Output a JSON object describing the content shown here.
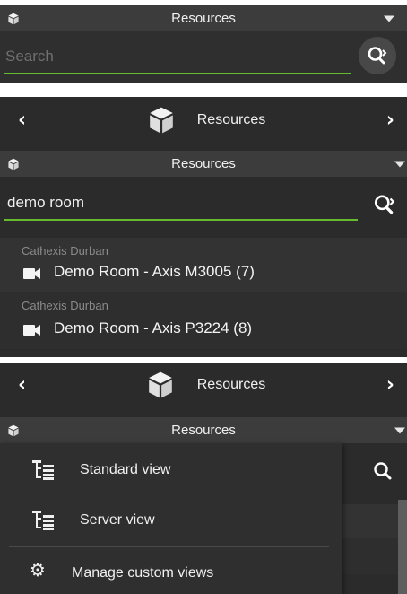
{
  "panel1": {
    "header": {
      "title": "Resources",
      "icon": "cube-icon",
      "dropdown_icon": "caret-down-icon"
    },
    "search": {
      "placeholder": "Search",
      "value": "",
      "button_icon": "search-icon"
    }
  },
  "panel2": {
    "nav": {
      "title": "Resources",
      "icon": "cube-icon",
      "back_icon": "chevron-left-icon",
      "forward_icon": "chevron-right-icon"
    },
    "header": {
      "title": "Resources",
      "icon": "cube-icon",
      "dropdown_icon": "caret-down-icon"
    },
    "search": {
      "value": "demo room",
      "button_icon": "search-icon"
    },
    "results": [
      {
        "site": "Cathexis Durban",
        "name": "Demo Room - Axis M3005 (7)",
        "icon": "camera-icon"
      },
      {
        "site": "Cathexis Durban",
        "name": "Demo Room - Axis P3224 (8)",
        "icon": "camera-icon"
      }
    ]
  },
  "panel3": {
    "nav": {
      "title": "Resources",
      "icon": "cube-icon",
      "back_icon": "chevron-left-icon",
      "forward_icon": "chevron-right-icon"
    },
    "header": {
      "title": "Resources",
      "icon": "cube-icon",
      "dropdown_icon": "caret-down-icon"
    },
    "search": {
      "button_icon": "search-icon"
    },
    "menu": [
      {
        "label": "Standard view",
        "icon": "tree-view-icon"
      },
      {
        "label": "Server view",
        "icon": "tree-view-icon"
      },
      {
        "label": "Manage custom views",
        "icon": "gear-icon"
      }
    ]
  },
  "colors": {
    "accent": "#66bb2f",
    "background": "#2b2b2b",
    "header": "#3c3c3c",
    "text": "#f0f0f0",
    "muted": "#8a8a8a"
  }
}
